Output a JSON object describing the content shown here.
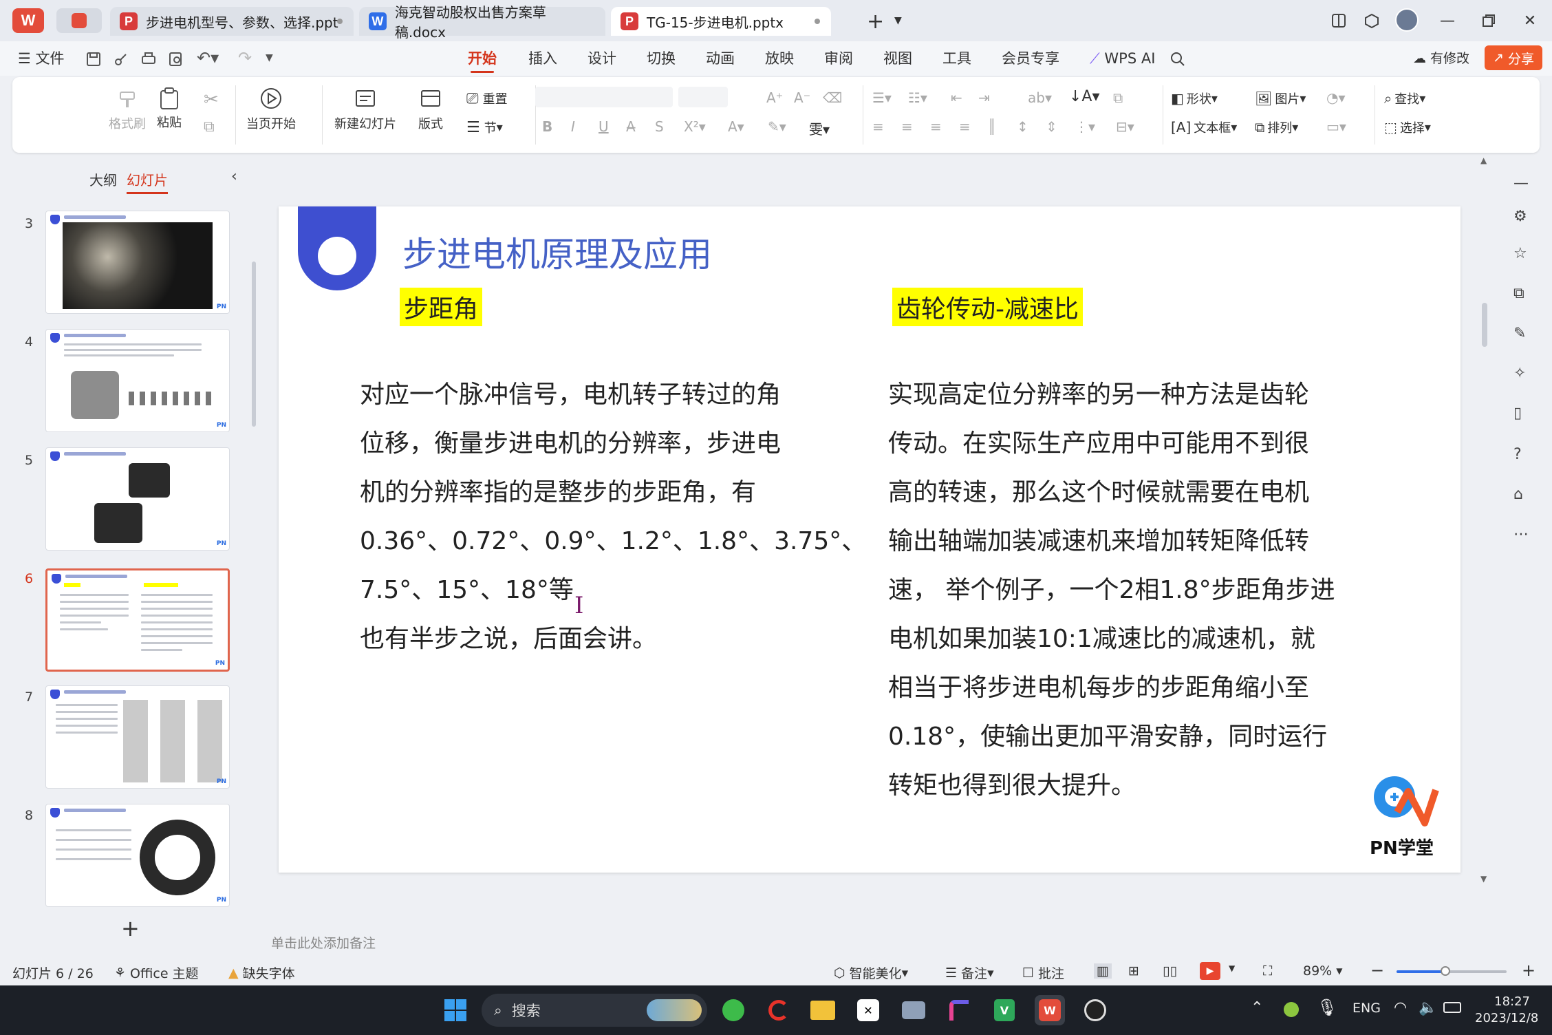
{
  "tabs": [
    {
      "label": "步进电机型号、参数、选择.ppt",
      "type": "ppt"
    },
    {
      "label": "海克智动股权出售方案草稿.docx",
      "type": "doc"
    },
    {
      "label": "TG-15-步进电机.pptx",
      "type": "ppt",
      "active": true
    }
  ],
  "menu": {
    "file": "文件",
    "items": [
      "开始",
      "插入",
      "设计",
      "切换",
      "动画",
      "放映",
      "审阅",
      "视图",
      "工具",
      "会员专享"
    ],
    "active": "开始",
    "wps_ai": "WPS AI",
    "youxiugai": "有修改",
    "share": "分享"
  },
  "ribbon": {
    "format_painter": "格式刷",
    "paste": "粘贴",
    "play_current": "当页开始",
    "new_slide": "新建幻灯片",
    "layout": "版式",
    "reset": "重置",
    "section": "节",
    "shape": "形状",
    "picture": "图片",
    "find": "查找",
    "textbox": "文本框",
    "arrange": "排列",
    "select": "选择"
  },
  "left_panel": {
    "tab_outline": "大纲",
    "tab_slides": "幻灯片",
    "thumbnails": [
      3,
      4,
      5,
      6,
      7,
      8
    ],
    "selected": 6
  },
  "slide": {
    "title": "步进电机原理及应用",
    "left_heading": "步距角",
    "right_heading": "齿轮传动-减速比",
    "left_lines": [
      "对应一个脉冲信号，电机转子转过的角",
      "位移，衡量步进电机的分辨率，步进电",
      "机的分辨率指的是整步的步距角，有",
      "0.36°、0.72°、0.9°、1.2°、1.8°、3.75°、",
      "7.5°、15°、18°等",
      "也有半步之说，后面会讲。"
    ],
    "right_lines": [
      "实现高定位分辨率的另一种方法是齿轮",
      "传动。在实际生产应用中可能用不到很",
      "高的转速，那么这个时候就需要在电机",
      "输出轴端加装减速机来增加转矩降低转",
      "速， 举个例子，一个2相1.8°步距角步进",
      "电机如果加装10:1减速比的减速机，就",
      "相当于将步进电机每步的步距角缩小至",
      "0.18°，使输出更加平滑安静，同时运行",
      "转矩也得到很大提升。"
    ],
    "logo_text": "PN学堂"
  },
  "notes_placeholder": "单击此处添加备注",
  "status": {
    "slide_counter": "幻灯片 6 / 26",
    "theme": "Office 主题",
    "missing_font": "缺失字体",
    "beautify": "智能美化",
    "notes": "备注",
    "comments": "批注",
    "zoom": "89%"
  },
  "taskbar": {
    "search": "搜索",
    "lang": "ENG",
    "time": "18:27",
    "date": "2023/12/8"
  },
  "colors": {
    "accent_red": "#d4351c",
    "title_blue": "#4561c6",
    "highlight_yellow": "#ffff00"
  }
}
